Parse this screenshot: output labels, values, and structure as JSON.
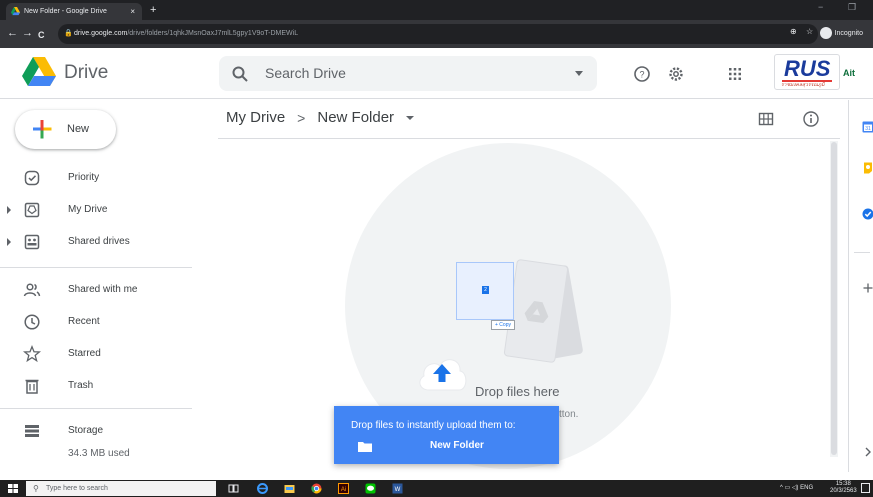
{
  "browser": {
    "tab_title": "New Folder - Google Drive",
    "tab_close": "×",
    "new_tab": "+",
    "url_host": "drive.google.com",
    "url_path": "/drive/folders/1qhkJMsnOaxJ7mlL5gpy1V9oT-DMEWiL",
    "incognito_label": "Incognito",
    "back": "←",
    "forward": "→",
    "reload": "C",
    "minimize": "−",
    "restore": "❐"
  },
  "header": {
    "product_name": "Drive",
    "search_placeholder": "Search Drive",
    "logo_brand": "RUS",
    "logo_tagline": "ราชมงคลสุวรรณภูมิ",
    "ait_logo": "Ait"
  },
  "sidebar": {
    "new_label": "New",
    "items": [
      {
        "label": "Priority",
        "icon": "priority-icon"
      },
      {
        "label": "My Drive",
        "icon": "my-drive-icon"
      },
      {
        "label": "Shared drives",
        "icon": "shared-drives-icon"
      },
      {
        "label": "Shared with me",
        "icon": "shared-with-me-icon"
      },
      {
        "label": "Recent",
        "icon": "recent-icon"
      },
      {
        "label": "Starred",
        "icon": "star-icon"
      },
      {
        "label": "Trash",
        "icon": "trash-icon"
      },
      {
        "label": "Storage",
        "icon": "storage-icon"
      }
    ],
    "storage_used": "34.3 MB used"
  },
  "main": {
    "breadcrumb_root": "My Drive",
    "breadcrumb_sep": ">",
    "breadcrumb_current": "New Folder",
    "drop_text": "Drop files here",
    "drop_subtext_fragment": "tton.",
    "drag_count": "2",
    "copy_chip": "+ Copy"
  },
  "toast": {
    "line1": "Drop files to instantly upload them to:",
    "folder_name": "New Folder"
  },
  "taskbar": {
    "search_placeholder": "Type here to search",
    "tray_lang": "ENG",
    "clock_time": "15:38",
    "clock_date": "20/3/2563"
  },
  "colors": {
    "accent": "#4285f4",
    "chrome_dark": "#202124"
  }
}
